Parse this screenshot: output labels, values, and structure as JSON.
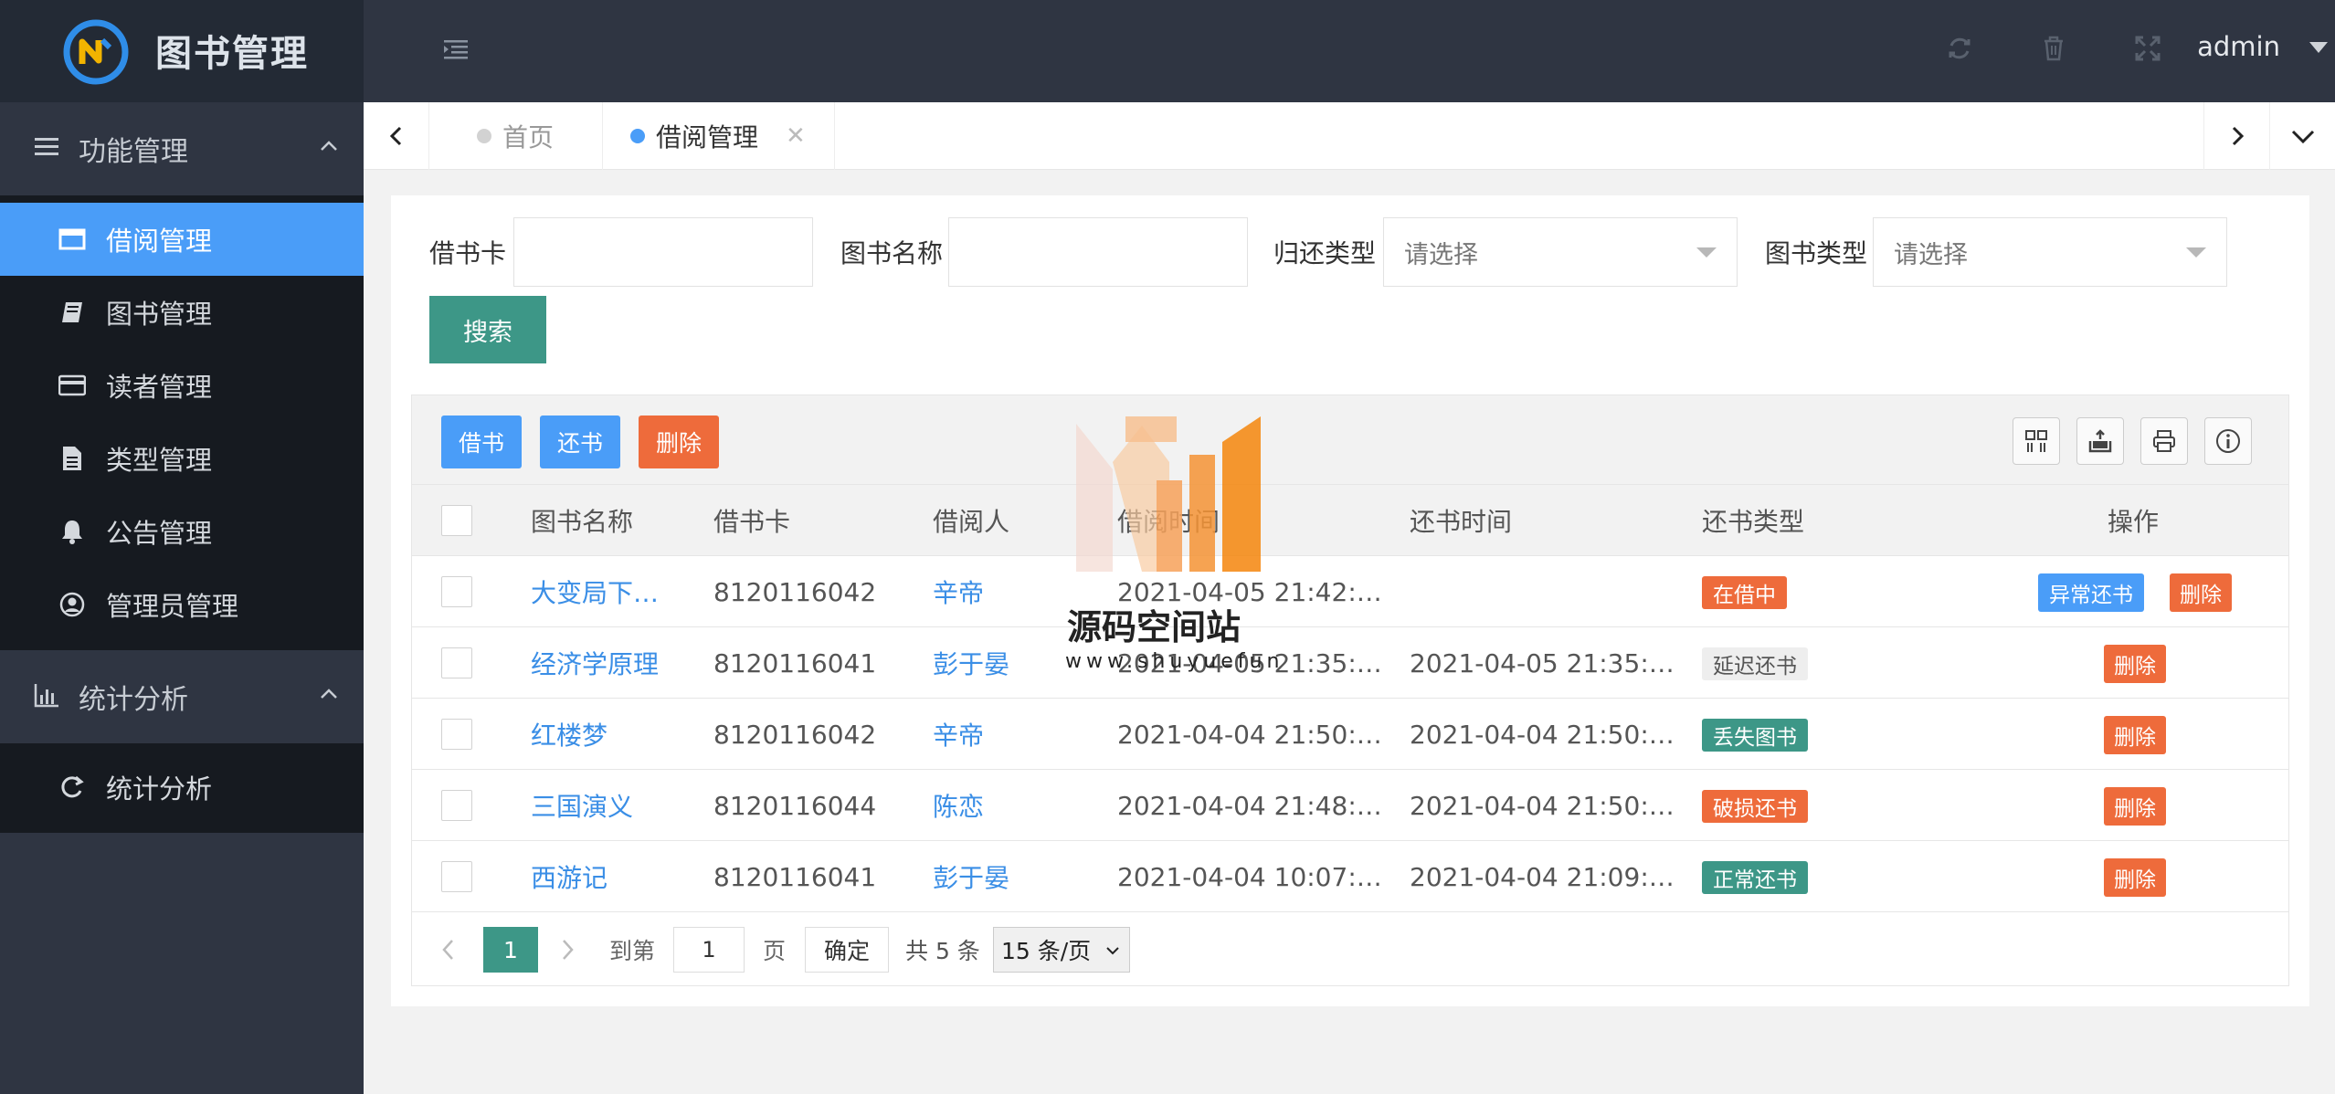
{
  "app": {
    "title": "图书管理",
    "user": "admin"
  },
  "sidebar": {
    "groups": [
      {
        "label": "功能管理",
        "items": [
          {
            "label": "借阅管理",
            "icon": "window-icon",
            "active": true
          },
          {
            "label": "图书管理",
            "icon": "book-icon"
          },
          {
            "label": "读者管理",
            "icon": "card-icon"
          },
          {
            "label": "类型管理",
            "icon": "document-icon"
          },
          {
            "label": "公告管理",
            "icon": "bell-icon"
          },
          {
            "label": "管理员管理",
            "icon": "user-circle-icon"
          }
        ]
      },
      {
        "label": "统计分析",
        "items": [
          {
            "label": "统计分析",
            "icon": "refresh-icon"
          }
        ]
      }
    ]
  },
  "tabs": [
    {
      "label": "首页",
      "active": false
    },
    {
      "label": "借阅管理",
      "active": true
    }
  ],
  "filters": {
    "card_label": "借书卡",
    "card_value": "",
    "book_name_label": "图书名称",
    "book_name_value": "",
    "return_type_label": "归还类型",
    "return_type_placeholder": "请选择",
    "book_type_label": "图书类型",
    "book_type_placeholder": "请选择",
    "search_button": "搜索"
  },
  "toolbar": {
    "borrow": "借书",
    "return": "还书",
    "delete": "删除"
  },
  "table": {
    "headers": [
      "图书名称",
      "借书卡",
      "借阅人",
      "借阅时间",
      "还书时间",
      "还书类型",
      "操作"
    ],
    "rows": [
      {
        "book": "大变局下…",
        "card": "8120116042",
        "reader": "辛帝",
        "borrow_time": "2021-04-05 21:42:…",
        "return_time": "",
        "status": "在借中",
        "status_color": "#ee6b3b",
        "actions": [
          "异常还书",
          "删除"
        ]
      },
      {
        "book": "经济学原理",
        "card": "8120116041",
        "reader": "彭于晏",
        "borrow_time": "2021-04-05 21:35:…",
        "return_time": "2021-04-05 21:35:…",
        "status": "延迟还书",
        "status_color": "#eeeeee",
        "actions": [
          "删除"
        ]
      },
      {
        "book": "红楼梦",
        "card": "8120116042",
        "reader": "辛帝",
        "borrow_time": "2021-04-04 21:50:…",
        "return_time": "2021-04-04 21:50:…",
        "status": "丢失图书",
        "status_color": "#3d9787",
        "actions": [
          "删除"
        ]
      },
      {
        "book": "三国演义",
        "card": "8120116044",
        "reader": "陈恋",
        "borrow_time": "2021-04-04 21:48:…",
        "return_time": "2021-04-04 21:50:…",
        "status": "破损还书",
        "status_color": "#ee6b3b",
        "actions": [
          "删除"
        ]
      },
      {
        "book": "西游记",
        "card": "8120116041",
        "reader": "彭于晏",
        "borrow_time": "2021-04-04 10:07:…",
        "return_time": "2021-04-04 21:09:…",
        "status": "正常还书",
        "status_color": "#3d9787",
        "actions": [
          "删除"
        ]
      }
    ]
  },
  "pager": {
    "current": "1",
    "goto_label": "到第",
    "goto_value": "1",
    "page_unit": "页",
    "confirm": "确定",
    "total": "共 5 条",
    "page_size": "15 条/页"
  },
  "watermark": {
    "title": "源码空间站",
    "url": "www.shuyuefun"
  },
  "colors": {
    "primary": "#3d9787",
    "blue": "#4a9df8",
    "orange": "#ee6b3b",
    "sidebar": "#2f3542",
    "menu": "#161a20"
  }
}
